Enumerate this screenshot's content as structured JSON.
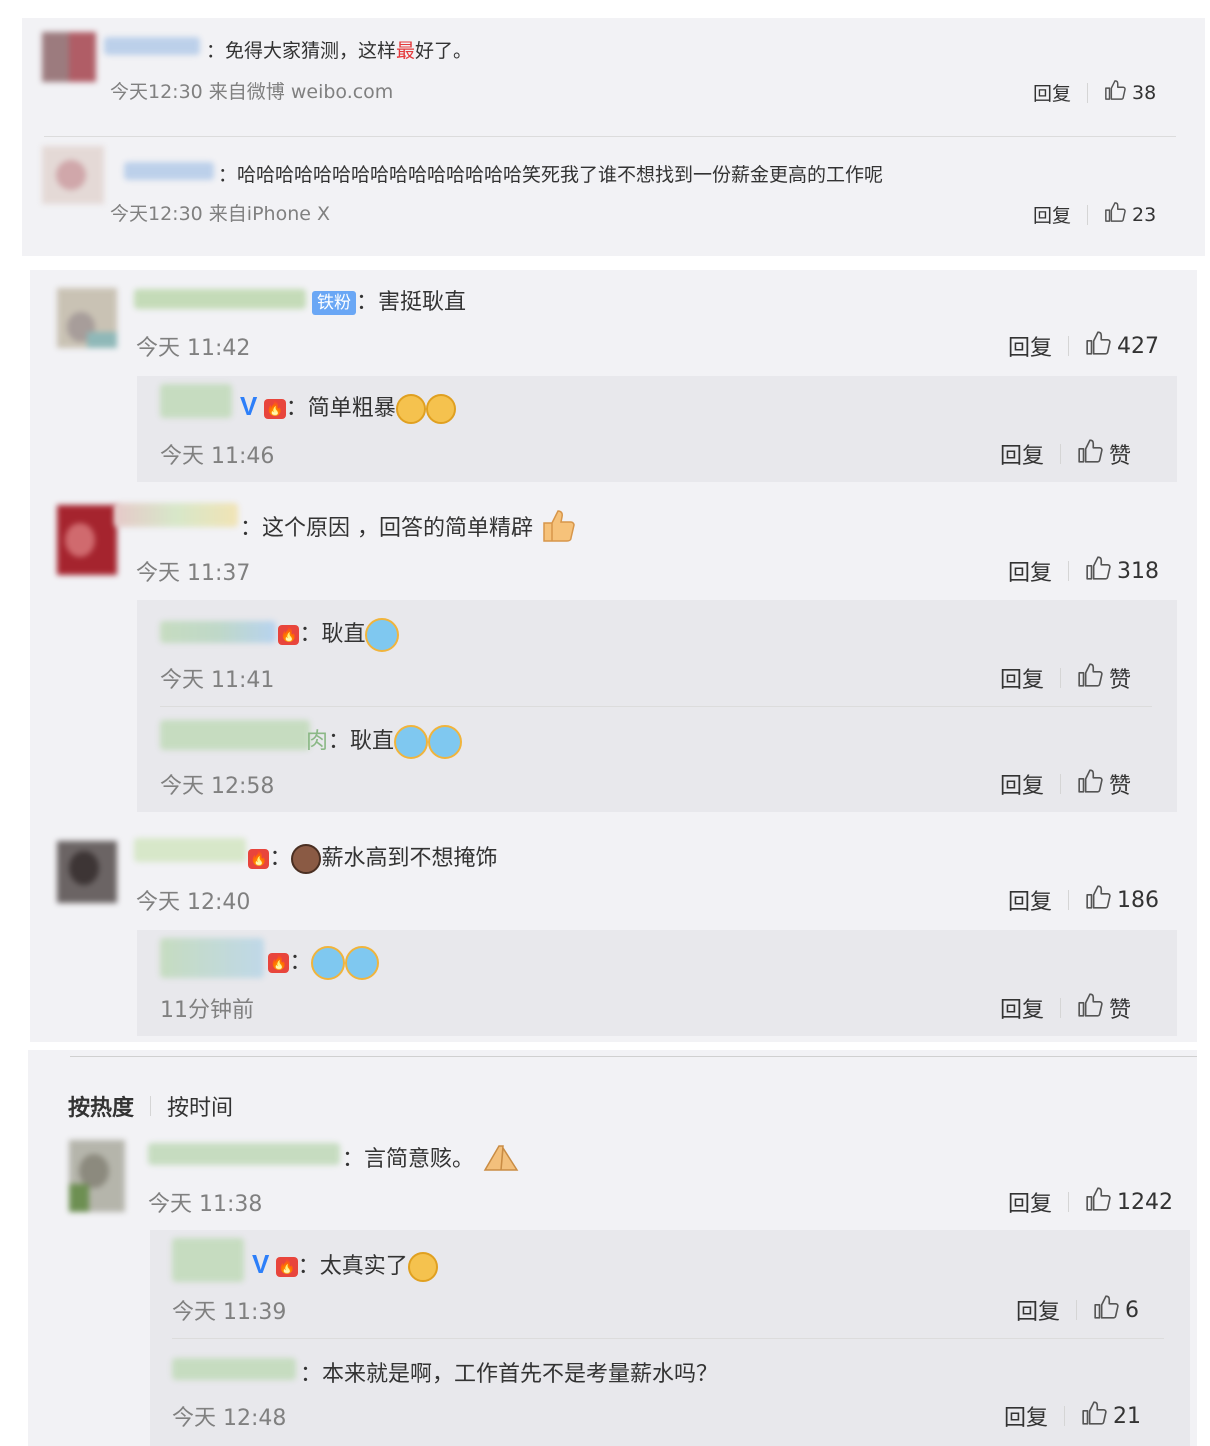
{
  "section1": {
    "comments": [
      {
        "text_pre": "：免得大家猜测，这样",
        "text_highlight": "最",
        "text_post": "好了。",
        "time": "今天12:30 来自微博 weibo.com",
        "reply": "回复",
        "likes": "38"
      },
      {
        "text": "：哈哈哈哈哈哈哈哈哈哈哈哈哈哈哈笑死我了谁不想找到一份薪金更高的工作呢",
        "time": "今天12:30 来自iPhone X",
        "reply": "回复",
        "likes": "23"
      }
    ]
  },
  "section2": {
    "threads": [
      {
        "badge": "铁粉",
        "text": "：害挺耿直",
        "time": "今天 11:42",
        "reply": "回复",
        "likes": "427",
        "replies": [
          {
            "verified": "V",
            "text": "：简单粗暴",
            "time": "今天 11:46",
            "reply": "回复",
            "like": "赞"
          }
        ]
      },
      {
        "text": "：这个原因 ，回答的简单精辟",
        "time": "今天 11:37",
        "reply": "回复",
        "likes": "318",
        "replies": [
          {
            "text": "：耿直",
            "time": "今天 11:41",
            "reply": "回复",
            "like": "赞"
          },
          {
            "name_tail": "肉",
            "text": "：耿直",
            "time": "今天 12:58",
            "reply": "回复",
            "like": "赞"
          }
        ]
      },
      {
        "text": "薪水高到不想掩饰",
        "time": "今天 12:40",
        "reply": "回复",
        "likes": "186",
        "replies": [
          {
            "text": "：",
            "time": "11分钟前",
            "reply": "回复",
            "like": "赞"
          }
        ]
      }
    ]
  },
  "section3": {
    "sort_hot": "按热度",
    "sort_time": "按时间",
    "thread": {
      "text": "：言简意赅。",
      "time": "今天 11:38",
      "reply": "回复",
      "likes": "1242",
      "replies": [
        {
          "verified": "V",
          "text": "：太真实了",
          "time": "今天 11:39",
          "reply": "回复",
          "likes": "6"
        },
        {
          "text": "：本来就是啊，工作首先不是考量薪水吗？",
          "time": "今天 12:48",
          "reply": "回复",
          "likes": "21"
        }
      ]
    }
  }
}
